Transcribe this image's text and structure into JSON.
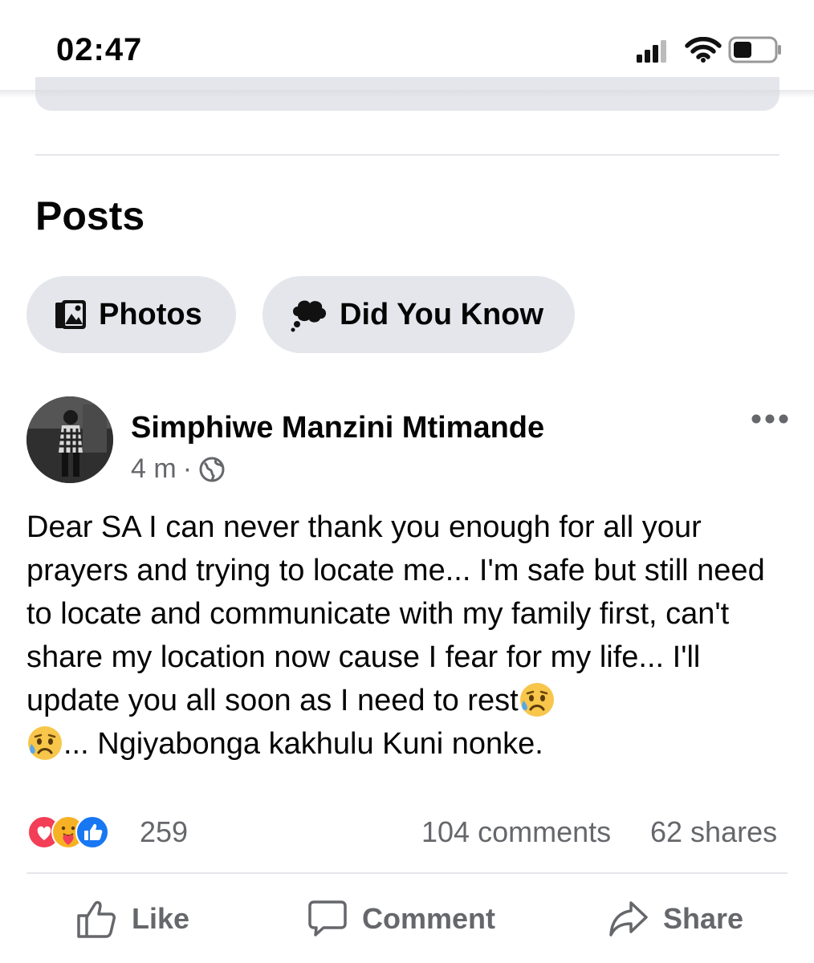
{
  "status_bar": {
    "time": "02:47"
  },
  "section": {
    "title": "Posts"
  },
  "chips": [
    {
      "label": "Photos",
      "icon": "photos-icon"
    },
    {
      "label": "Did You Know",
      "icon": "thought-bubble-icon"
    }
  ],
  "post": {
    "author": "Simphiwe Manzini Mtimande",
    "time": "4 m",
    "separator": "·",
    "audience_icon": "globe-icon",
    "text_part1": "Dear SA I can never thank you enough for all your prayers and trying to locate me... I'm safe but still need to locate and communicate with my family first, can't share my location now cause I fear for my life... I'll update you all soon as I need to rest",
    "text_part2": "... Ngiyabonga kakhulu Kuni nonke.",
    "emoji": "sad-relieved-face-emoji",
    "reactions": [
      "love",
      "care",
      "like"
    ],
    "reaction_count": "259",
    "comments": "104 comments",
    "shares": "62 shares"
  },
  "actions": {
    "like": "Like",
    "comment": "Comment",
    "share": "Share"
  },
  "colors": {
    "chip_bg": "#e4e6eb",
    "secondary_text": "#65676b",
    "like_blue": "#1877f2",
    "love_red": "#f33e58",
    "care_yellow": "#f7b125"
  }
}
